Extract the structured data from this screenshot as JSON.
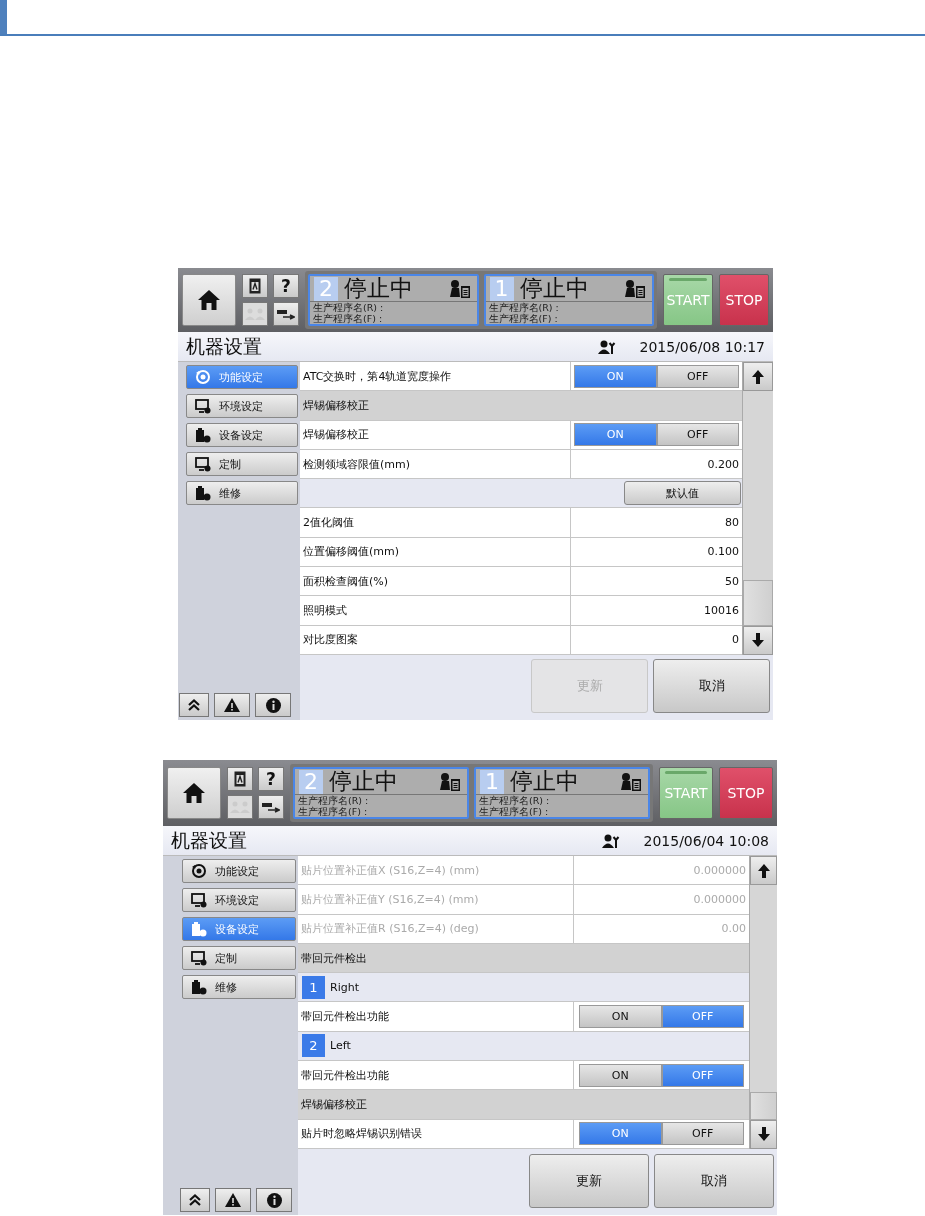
{
  "screens": [
    {
      "header": {
        "help_label": "?",
        "lanes": [
          {
            "number": "2",
            "status": "停止中",
            "program_lines": [
              "生产程序名(R) :",
              "生产程序名(F) :"
            ]
          },
          {
            "number": "1",
            "status": "停止中",
            "program_lines": [
              "生产程序名(R) :",
              "生产程序名(F) :"
            ]
          }
        ],
        "start_label": "START",
        "stop_label": "STOP"
      },
      "title": "机器设置",
      "datetime": "2015/06/08 10:17",
      "sidebar": [
        {
          "label": "功能设定",
          "selected": true
        },
        {
          "label": "环境设定",
          "selected": false
        },
        {
          "label": "设备设定",
          "selected": false
        },
        {
          "label": "定制",
          "selected": false
        },
        {
          "label": "维修",
          "selected": false
        }
      ],
      "rows": [
        {
          "kind": "toggle",
          "label": "ATC交换时，第4轨道宽度操作",
          "options": [
            {
              "label": "ON",
              "selected": true
            },
            {
              "label": "OFF",
              "selected": false
            }
          ]
        },
        {
          "kind": "section",
          "label": "焊锡偏移校正"
        },
        {
          "kind": "toggle",
          "label": "焊锡偏移校正",
          "options": [
            {
              "label": "ON",
              "selected": true
            },
            {
              "label": "OFF",
              "selected": false
            }
          ]
        },
        {
          "kind": "value",
          "label": "检测领域容限值(mm)",
          "value": "0.200",
          "disabled": false
        },
        {
          "kind": "button",
          "label": "默认值"
        },
        {
          "kind": "value",
          "label": "2值化阈值",
          "value": "80",
          "disabled": false
        },
        {
          "kind": "value",
          "label": "位置偏移阈值(mm)",
          "value": "0.100",
          "disabled": false
        },
        {
          "kind": "value",
          "label": "面积检查阈值(%)",
          "value": "50",
          "disabled": false
        },
        {
          "kind": "value",
          "label": "照明模式",
          "value": "10016",
          "disabled": false
        },
        {
          "kind": "value",
          "label": "对比度图案",
          "value": "0",
          "disabled": false
        }
      ],
      "buttons": [
        {
          "label": "更新",
          "disabled": true
        },
        {
          "label": "取消",
          "disabled": false
        }
      ]
    },
    {
      "header": {
        "help_label": "?",
        "lanes": [
          {
            "number": "2",
            "status": "停止中",
            "program_lines": [
              "生产程序名(R) :",
              "生产程序名(F) :"
            ]
          },
          {
            "number": "1",
            "status": "停止中",
            "program_lines": [
              "生产程序名(R) :",
              "生产程序名(F) :"
            ]
          }
        ],
        "start_label": "START",
        "stop_label": "STOP"
      },
      "title": "机器设置",
      "datetime": "2015/06/04 10:08",
      "sidebar": [
        {
          "label": "功能设定",
          "selected": false
        },
        {
          "label": "环境设定",
          "selected": false
        },
        {
          "label": "设备设定",
          "selected": true
        },
        {
          "label": "定制",
          "selected": false
        },
        {
          "label": "维修",
          "selected": false
        }
      ],
      "rows": [
        {
          "kind": "value",
          "label": "贴片位置补正值X (S16,Z=4) (mm)",
          "value": "0.000000",
          "disabled": true
        },
        {
          "kind": "value",
          "label": "贴片位置补正值Y (S16,Z=4) (mm)",
          "value": "0.000000",
          "disabled": true
        },
        {
          "kind": "value",
          "label": "贴片位置补正值R (S16,Z=4) (deg)",
          "value": "0.00",
          "disabled": true
        },
        {
          "kind": "section",
          "label": "带回元件检出"
        },
        {
          "kind": "lane",
          "number": "1",
          "label": "Right"
        },
        {
          "kind": "toggle",
          "label": "带回元件检出功能",
          "options": [
            {
              "label": "ON",
              "selected": false
            },
            {
              "label": "OFF",
              "selected": true
            }
          ]
        },
        {
          "kind": "lane",
          "number": "2",
          "label": "Left"
        },
        {
          "kind": "toggle",
          "label": "带回元件检出功能",
          "options": [
            {
              "label": "ON",
              "selected": false
            },
            {
              "label": "OFF",
              "selected": true
            }
          ]
        },
        {
          "kind": "section",
          "label": "焊锡偏移校正"
        },
        {
          "kind": "toggle",
          "label": "贴片时忽略焊锡识别错误",
          "options": [
            {
              "label": "ON",
              "selected": true
            },
            {
              "label": "OFF",
              "selected": false
            }
          ]
        }
      ],
      "buttons": [
        {
          "label": "更新",
          "disabled": false
        },
        {
          "label": "取消",
          "disabled": false
        }
      ]
    }
  ]
}
